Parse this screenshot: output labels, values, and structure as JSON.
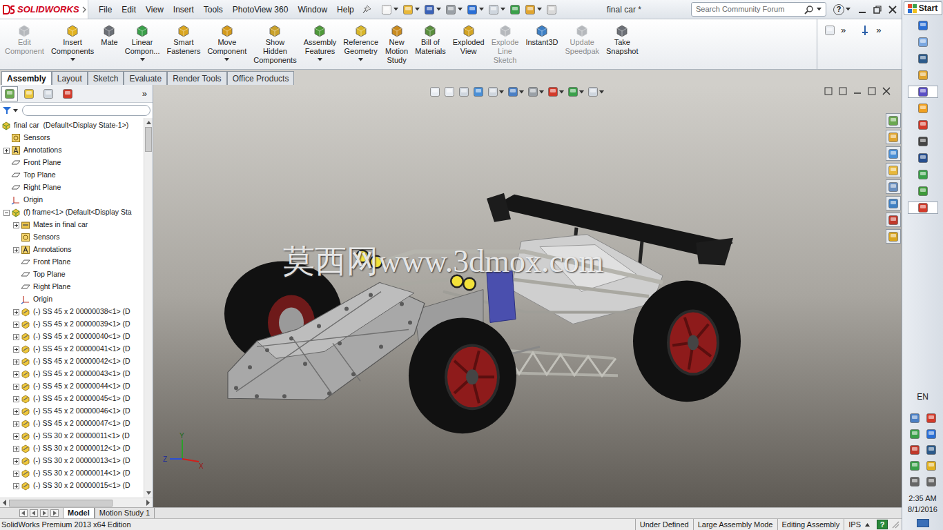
{
  "app": {
    "logo": "SOLIDWORKS",
    "title": "final car *"
  },
  "menu": [
    "File",
    "Edit",
    "View",
    "Insert",
    "Tools",
    "PhotoView 360",
    "Window",
    "Help"
  ],
  "search": {
    "placeholder": "Search Community Forum"
  },
  "help": "?",
  "ribbon": [
    {
      "lines": [
        "Edit",
        "Component"
      ],
      "dropdown": false,
      "disabled": true
    },
    {
      "lines": [
        "Insert",
        "Components"
      ],
      "dropdown": true,
      "disabled": false
    },
    {
      "lines": [
        "Mate"
      ],
      "dropdown": false,
      "disabled": false
    },
    {
      "lines": [
        "Linear",
        "Compon..."
      ],
      "dropdown": true,
      "disabled": false
    },
    {
      "lines": [
        "Smart",
        "Fasteners"
      ],
      "dropdown": false,
      "disabled": false
    },
    {
      "lines": [
        "Move",
        "Component"
      ],
      "dropdown": true,
      "disabled": false
    },
    {
      "lines": [
        "Show",
        "Hidden",
        "Components"
      ],
      "dropdown": false,
      "disabled": false
    },
    {
      "lines": [
        "Assembly",
        "Features"
      ],
      "dropdown": true,
      "disabled": false
    },
    {
      "lines": [
        "Reference",
        "Geometry"
      ],
      "dropdown": true,
      "disabled": false
    },
    {
      "lines": [
        "New",
        "Motion",
        "Study"
      ],
      "dropdown": false,
      "disabled": false
    },
    {
      "lines": [
        "Bill of",
        "Materials"
      ],
      "dropdown": false,
      "disabled": false
    },
    {
      "lines": [
        "Exploded",
        "View"
      ],
      "dropdown": false,
      "disabled": false
    },
    {
      "lines": [
        "Explode",
        "Line",
        "Sketch"
      ],
      "dropdown": false,
      "disabled": true
    },
    {
      "lines": [
        "Instant3D"
      ],
      "dropdown": false,
      "disabled": false
    },
    {
      "lines": [
        "Update",
        "Speedpak"
      ],
      "dropdown": false,
      "disabled": true
    },
    {
      "lines": [
        "Take",
        "Snapshot"
      ],
      "dropdown": false,
      "disabled": false
    }
  ],
  "ribbon_more": [
    "»",
    "»"
  ],
  "tabs": [
    {
      "label": "Assembly",
      "selected": true
    },
    {
      "label": "Layout",
      "selected": false
    },
    {
      "label": "Sketch",
      "selected": false
    },
    {
      "label": "Evaluate",
      "selected": false
    },
    {
      "label": "Render Tools",
      "selected": false
    },
    {
      "label": "Office Products",
      "selected": false
    }
  ],
  "panel": {
    "more": "»",
    "tree": [
      {
        "label": "final car  (Default<Display State-1>)",
        "depth": 0,
        "kind": "assembly",
        "expandable": false,
        "expanded": false
      },
      {
        "label": "Sensors",
        "depth": 1,
        "kind": "sensors",
        "expandable": false,
        "expanded": false
      },
      {
        "label": "Annotations",
        "depth": 1,
        "kind": "annotations",
        "expandable": true,
        "expanded": false
      },
      {
        "label": "Front Plane",
        "depth": 1,
        "kind": "plane",
        "expandable": false,
        "expanded": false
      },
      {
        "label": "Top Plane",
        "depth": 1,
        "kind": "plane",
        "expandable": false,
        "expanded": false
      },
      {
        "label": "Right Plane",
        "depth": 1,
        "kind": "plane",
        "expandable": false,
        "expanded": false
      },
      {
        "label": "Origin",
        "depth": 1,
        "kind": "origin",
        "expandable": false,
        "expanded": false
      },
      {
        "label": "(f) frame<1> (Default<Display Sta",
        "depth": 1,
        "kind": "assembly",
        "expandable": true,
        "expanded": true
      },
      {
        "label": "Mates in final car",
        "depth": 2,
        "kind": "mates",
        "expandable": true,
        "expanded": false
      },
      {
        "label": "Sensors",
        "depth": 2,
        "kind": "sensors",
        "expandable": false,
        "expanded": false
      },
      {
        "label": "Annotations",
        "depth": 2,
        "kind": "annotations",
        "expandable": true,
        "expanded": false
      },
      {
        "label": "Front Plane",
        "depth": 2,
        "kind": "plane",
        "expandable": false,
        "expanded": false
      },
      {
        "label": "Top Plane",
        "depth": 2,
        "kind": "plane",
        "expandable": false,
        "expanded": false
      },
      {
        "label": "Right Plane",
        "depth": 2,
        "kind": "plane",
        "expandable": false,
        "expanded": false
      },
      {
        "label": "Origin",
        "depth": 2,
        "kind": "origin",
        "expandable": false,
        "expanded": false
      },
      {
        "label": "(-) SS 45 x 2 00000038<1> (D",
        "depth": 2,
        "kind": "part",
        "expandable": true,
        "expanded": false
      },
      {
        "label": "(-) SS 45 x 2 00000039<1> (D",
        "depth": 2,
        "kind": "part",
        "expandable": true,
        "expanded": false
      },
      {
        "label": "(-) SS 45 x 2 00000040<1> (D",
        "depth": 2,
        "kind": "part",
        "expandable": true,
        "expanded": false
      },
      {
        "label": "(-) SS 45 x 2 00000041<1> (D",
        "depth": 2,
        "kind": "part",
        "expandable": true,
        "expanded": false
      },
      {
        "label": "(-) SS 45 x 2 00000042<1> (D",
        "depth": 2,
        "kind": "part",
        "expandable": true,
        "expanded": false
      },
      {
        "label": "(-) SS 45 x 2 00000043<1> (D",
        "depth": 2,
        "kind": "part",
        "expandable": true,
        "expanded": false
      },
      {
        "label": "(-) SS 45 x 2 00000044<1> (D",
        "depth": 2,
        "kind": "part",
        "expandable": true,
        "expanded": false
      },
      {
        "label": "(-) SS 45 x 2 00000045<1> (D",
        "depth": 2,
        "kind": "part",
        "expandable": true,
        "expanded": false
      },
      {
        "label": "(-) SS 45 x 2 00000046<1> (D",
        "depth": 2,
        "kind": "part",
        "expandable": true,
        "expanded": false
      },
      {
        "label": "(-) SS 45 x 2 00000047<1> (D",
        "depth": 2,
        "kind": "part",
        "expandable": true,
        "expanded": false
      },
      {
        "label": "(-) SS 30 x 2 00000011<1> (D",
        "depth": 2,
        "kind": "part",
        "expandable": true,
        "expanded": false
      },
      {
        "label": "(-) SS 30 x 2 00000012<1> (D",
        "depth": 2,
        "kind": "part",
        "expandable": true,
        "expanded": false
      },
      {
        "label": "(-) SS 30 x 2 00000013<1> (D",
        "depth": 2,
        "kind": "part",
        "expandable": true,
        "expanded": false
      },
      {
        "label": "(-) SS 30 x 2 00000014<1> (D",
        "depth": 2,
        "kind": "part",
        "expandable": true,
        "expanded": false
      },
      {
        "label": "(-) SS 30 x 2 00000015<1> (D",
        "depth": 2,
        "kind": "part",
        "expandable": true,
        "expanded": false
      }
    ]
  },
  "watermark": "莫西网www.3dmox.com",
  "triad": {
    "y": "Y",
    "z": "Z",
    "x": "X"
  },
  "bottom_tabs": [
    {
      "label": "Model",
      "selected": true
    },
    {
      "label": "Motion Study 1",
      "selected": false
    }
  ],
  "status_bar": {
    "edition": "SolidWorks Premium 2013 x64 Edition",
    "items": [
      "Under Defined",
      "Large Assembly Mode",
      "Editing Assembly",
      "IPS"
    ],
    "help": "?"
  },
  "taskbar": {
    "start": "Start",
    "language": "EN",
    "time": "2:35 AM",
    "date": "8/1/2016"
  }
}
